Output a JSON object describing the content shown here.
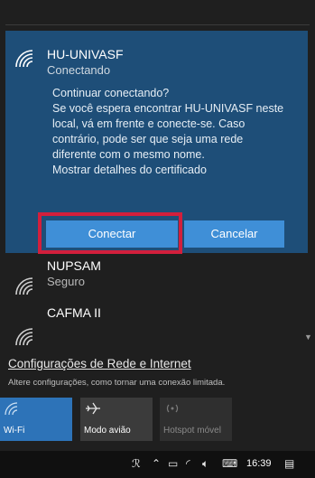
{
  "selected_network": {
    "name": "HU-UNIVASF",
    "status": "Conectando",
    "message_lines": [
      "Continuar conectando?",
      "Se você espera encontrar HU-UNIVASF neste",
      "local, vá em frente e conecte-se. Caso",
      "contrário, pode ser que seja uma rede",
      "diferente com o mesmo nome.",
      "Mostrar detalhes do certificado"
    ],
    "connect_label": "Conectar",
    "cancel_label": "Cancelar",
    "highlight_color": "#d21f3c"
  },
  "other_networks": [
    {
      "name": "NUPSAM",
      "status": "Seguro"
    },
    {
      "name": "CAFMA II",
      "status": ""
    }
  ],
  "settings": {
    "link": "Configurações de Rede e Internet",
    "description": "Altere configurações, como tornar uma conexão limitada."
  },
  "quick_actions": [
    {
      "label": "Wi-Fi",
      "icon": "wifi-icon",
      "active": true
    },
    {
      "label": "Modo avião",
      "icon": "airplane-icon",
      "active": false
    },
    {
      "label": "Hotspot móvel",
      "icon": "hotspot-icon",
      "active": false
    }
  ],
  "taskbar": {
    "time": "16:39",
    "icons": [
      "people-icon",
      "chevron-up-icon",
      "battery-icon",
      "wifi-icon",
      "volume-icon",
      "keyboard-icon",
      "action-center-icon"
    ]
  },
  "colors": {
    "accent": "#3f8fd7",
    "selected_bg": "#1e4e78",
    "tile_active": "#2d73b8"
  }
}
